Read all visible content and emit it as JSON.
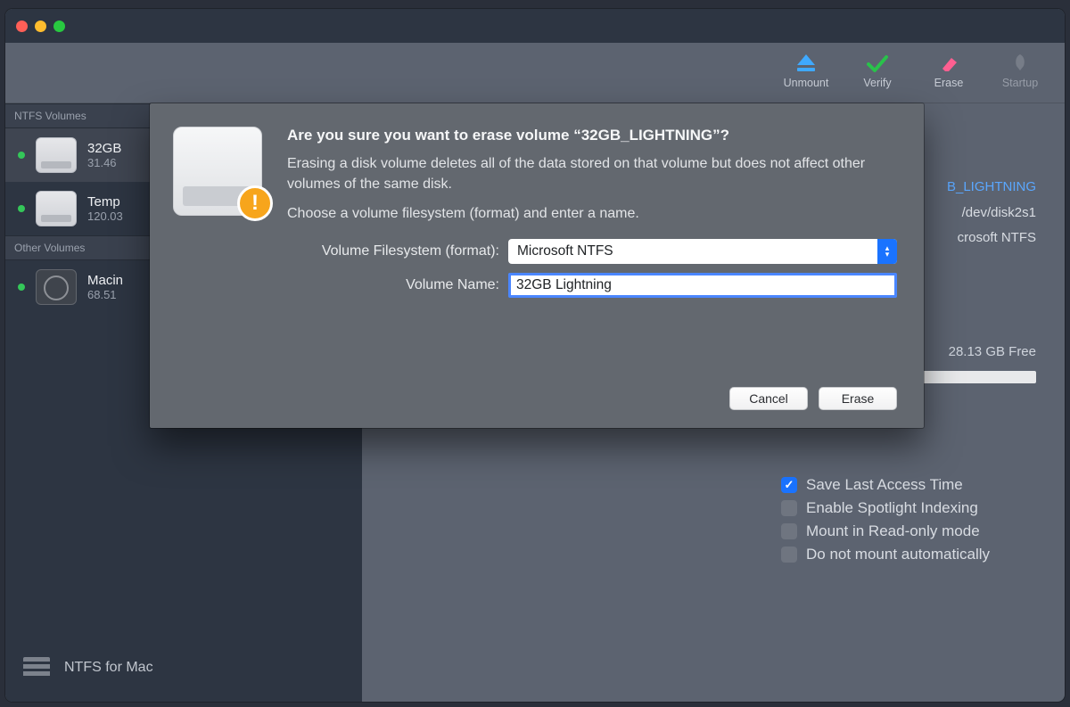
{
  "toolbar": {
    "unmount": "Unmount",
    "verify": "Verify",
    "erase": "Erase",
    "startup": "Startup"
  },
  "sidebar": {
    "section_ntfs": "NTFS Volumes",
    "section_other": "Other Volumes",
    "items": [
      {
        "name": "32GB",
        "sub": "31.46"
      },
      {
        "name": "Temp",
        "sub": "120.03"
      },
      {
        "name": "Macin",
        "sub": "68.51"
      }
    ],
    "footer": "NTFS for Mac"
  },
  "details": {
    "volume_hl": "B_LIGHTNING",
    "device": "/dev/disk2s1",
    "fs": "crosoft NTFS",
    "free": "28.13 GB Free"
  },
  "options": {
    "opt0": "Save Last Access Time",
    "opt1": "Enable Spotlight Indexing",
    "opt2": "Mount in Read-only mode",
    "opt3": "Do not mount automatically"
  },
  "modal": {
    "title": "Are you sure you want to erase volume “32GB_LIGHTNING”?",
    "text1": "Erasing a disk volume deletes all of the data stored on that volume but does not affect other volumes of the same disk.",
    "text2": "Choose a volume filesystem (format) and enter a name.",
    "label_format": "Volume Filesystem (format):",
    "format_value": "Microsoft NTFS",
    "label_name": "Volume Name:",
    "name_value": "32GB Lightning",
    "cancel": "Cancel",
    "erase": "Erase"
  }
}
